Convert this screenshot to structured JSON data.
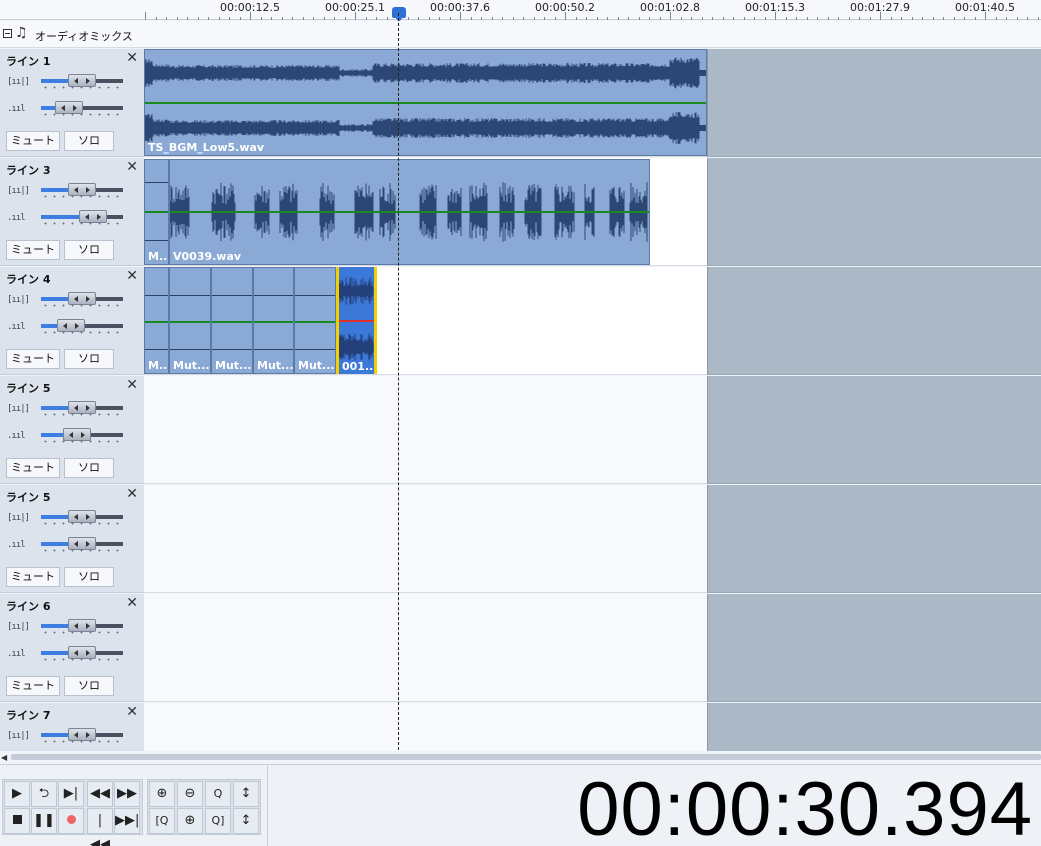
{
  "ruler": {
    "ticks": [
      "00:00:12.5",
      "00:00:25.1",
      "00:00:37.6",
      "00:00:50.2",
      "00:01:02.8",
      "00:01:15.3",
      "00:01:27.9",
      "00:01:40.5"
    ]
  },
  "mix": {
    "title": "オーディオミックス",
    "collapse_icon": "collapse-box-icon",
    "note_icon": "music-note-icon"
  },
  "tracks": [
    {
      "name": "ライン 1",
      "mute": "ミュート",
      "solo": "ソロ",
      "volume": 0.5,
      "pan": 0.25
    },
    {
      "name": "ライン 3",
      "mute": "ミュート",
      "solo": "ソロ",
      "volume": 0.5,
      "pan": 0.7
    },
    {
      "name": "ライン 4",
      "mute": "ミュート",
      "solo": "ソロ",
      "volume": 0.5,
      "pan": 0.3
    },
    {
      "name": "ライン 5",
      "mute": "ミュート",
      "solo": "ソロ",
      "volume": 0.5,
      "pan": 0.4
    },
    {
      "name": "ライン 5",
      "mute": "ミュート",
      "solo": "ソロ",
      "volume": 0.5,
      "pan": 0.5
    },
    {
      "name": "ライン 6",
      "mute": "ミュート",
      "solo": "ソロ",
      "volume": 0.5,
      "pan": 0.5
    },
    {
      "name": "ライン 7",
      "mute": "ミュート",
      "solo": "ソロ",
      "volume": 0.5,
      "pan": 0.5
    }
  ],
  "clips": {
    "track1": {
      "label": "TS_BGM_Low5.wav"
    },
    "track3": {
      "labels": [
        "M..",
        "V0039.wav"
      ]
    },
    "track4": {
      "labels": [
        "M..",
        "Mut...",
        "Mut...",
        "Mut...",
        "Mut...",
        "001..."
      ]
    }
  },
  "transport": {
    "row1": [
      "play-icon",
      "loop-icon",
      "next-marker-icon",
      "rewind-icon",
      "fast-forward-icon"
    ],
    "row2": [
      "stop-icon",
      "pause-icon",
      "record-icon",
      "go-to-start-icon",
      "go-to-end-icon"
    ],
    "zoom_row1": [
      "zoom-in-icon",
      "zoom-out-icon",
      "zoom-100-icon",
      "zoom-vertical-icon"
    ],
    "zoom_row2": [
      "zoom-fit-left-icon",
      "zoom-selection-icon",
      "zoom-fit-right-icon",
      "zoom-vertical-fit-icon"
    ]
  },
  "time_display": "00:00:30.394",
  "colors": {
    "accent": "#3d7ee0",
    "clip": "#8aa9d4",
    "envelope": "#1a8a1a",
    "selected_clip": "#f5d000"
  }
}
